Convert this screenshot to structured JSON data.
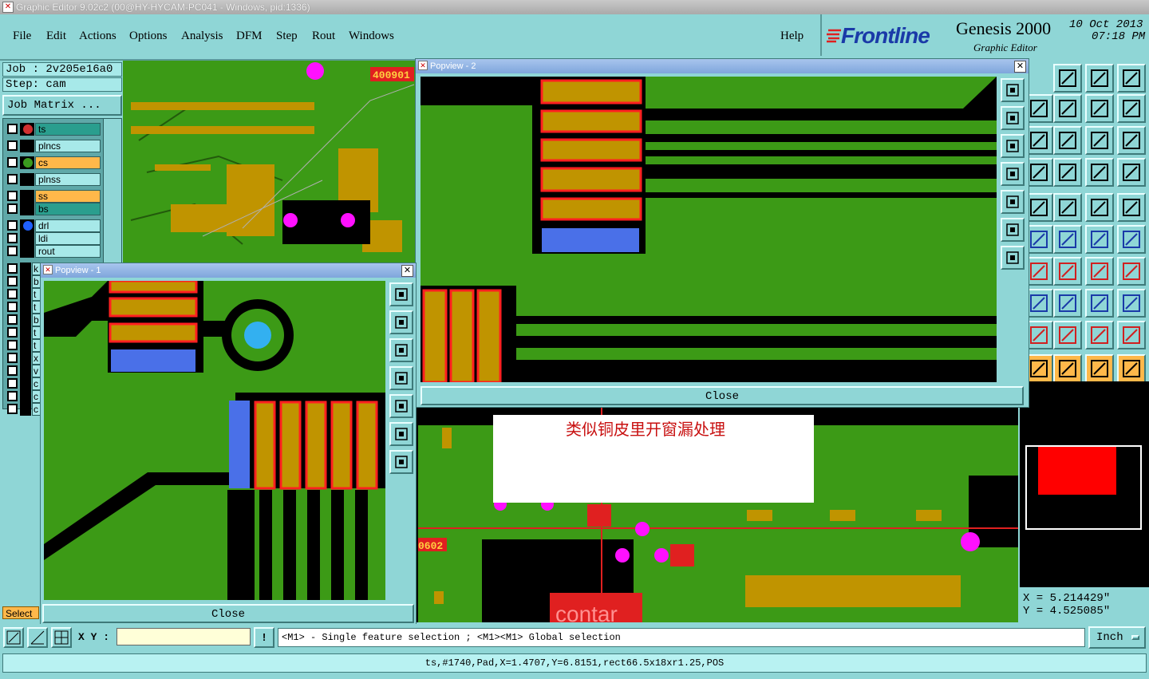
{
  "window": {
    "title": "Graphic Editor 9.02c2 (00@HY-HYCAM-PC041 - Windows, pid:1336)"
  },
  "menu": [
    "File",
    "Edit",
    "Actions",
    "Options",
    "Analysis",
    "DFM",
    "Step",
    "Rout",
    "Windows"
  ],
  "help_label": "Help",
  "brand": {
    "logo": "Frontline",
    "product": "Genesis 2000",
    "subtitle": "Graphic Editor",
    "date": "10 Oct 2013",
    "time": "07:18 PM"
  },
  "job": {
    "job_label": "Job : 2v205e16a0",
    "step_label": "Step: cam",
    "matrix_button": "Job Matrix ..."
  },
  "layers": [
    {
      "name": "ts",
      "color": "#2a9e8e",
      "swatch": "#d03030",
      "flag": true
    },
    {
      "name": "plncs",
      "color": "#a7e9e9",
      "swatch": "#000000",
      "flag": false
    },
    {
      "name": "cs",
      "color": "#ffb84a",
      "swatch": "#3a9a1e",
      "flag": true
    },
    {
      "name": "plnss",
      "color": "#a7e9e9",
      "swatch": "#000000",
      "flag": false
    },
    {
      "name": "ss",
      "color": "#ffb84a",
      "swatch": "#000000",
      "flag": true
    },
    {
      "name": "bs",
      "color": "#2a9e8e",
      "swatch": "#000000",
      "flag": true
    },
    {
      "name": "drl",
      "color": "#a7e9e9",
      "swatch": "#2060ff",
      "flag": false
    },
    {
      "name": "ldi",
      "color": "#a7e9e9",
      "swatch": "#000000",
      "flag": false
    },
    {
      "name": "rout",
      "color": "#a7e9e9",
      "swatch": "#000000",
      "flag": false
    }
  ],
  "layer_letters": [
    "k",
    "b",
    "t",
    "t",
    "b",
    "t",
    "t",
    "x",
    "v",
    "c",
    "c",
    "c"
  ],
  "popview1": {
    "title": "Popview - 1",
    "close": "Close"
  },
  "popview2": {
    "title": "Popview - 2",
    "close": "Close"
  },
  "annotation": "类似铜皮里开窗漏处理",
  "canvas_labels": {
    "top_code": "400901",
    "mid_code": "0602",
    "logo_text": "contar"
  },
  "coords": {
    "x": "X = 5.214429\"",
    "y": "Y = 4.525085\""
  },
  "select_label": "Select",
  "xy_label": "X Y :",
  "xy_value": "",
  "prompt": "<M1> - Single feature selection ; <M1><M1> Global selection",
  "unit": "Inch",
  "status": "ts,#1740,Pad,X=1.4707,Y=6.8151,rect66.5x18xr1.25,POS",
  "colors": {
    "board": "#3c9a16",
    "copper": "#c09400",
    "pad_outline": "#ff2020",
    "blue": "#4a70e8",
    "magenta": "#ff10ff",
    "panel": "#8fd6d6"
  }
}
